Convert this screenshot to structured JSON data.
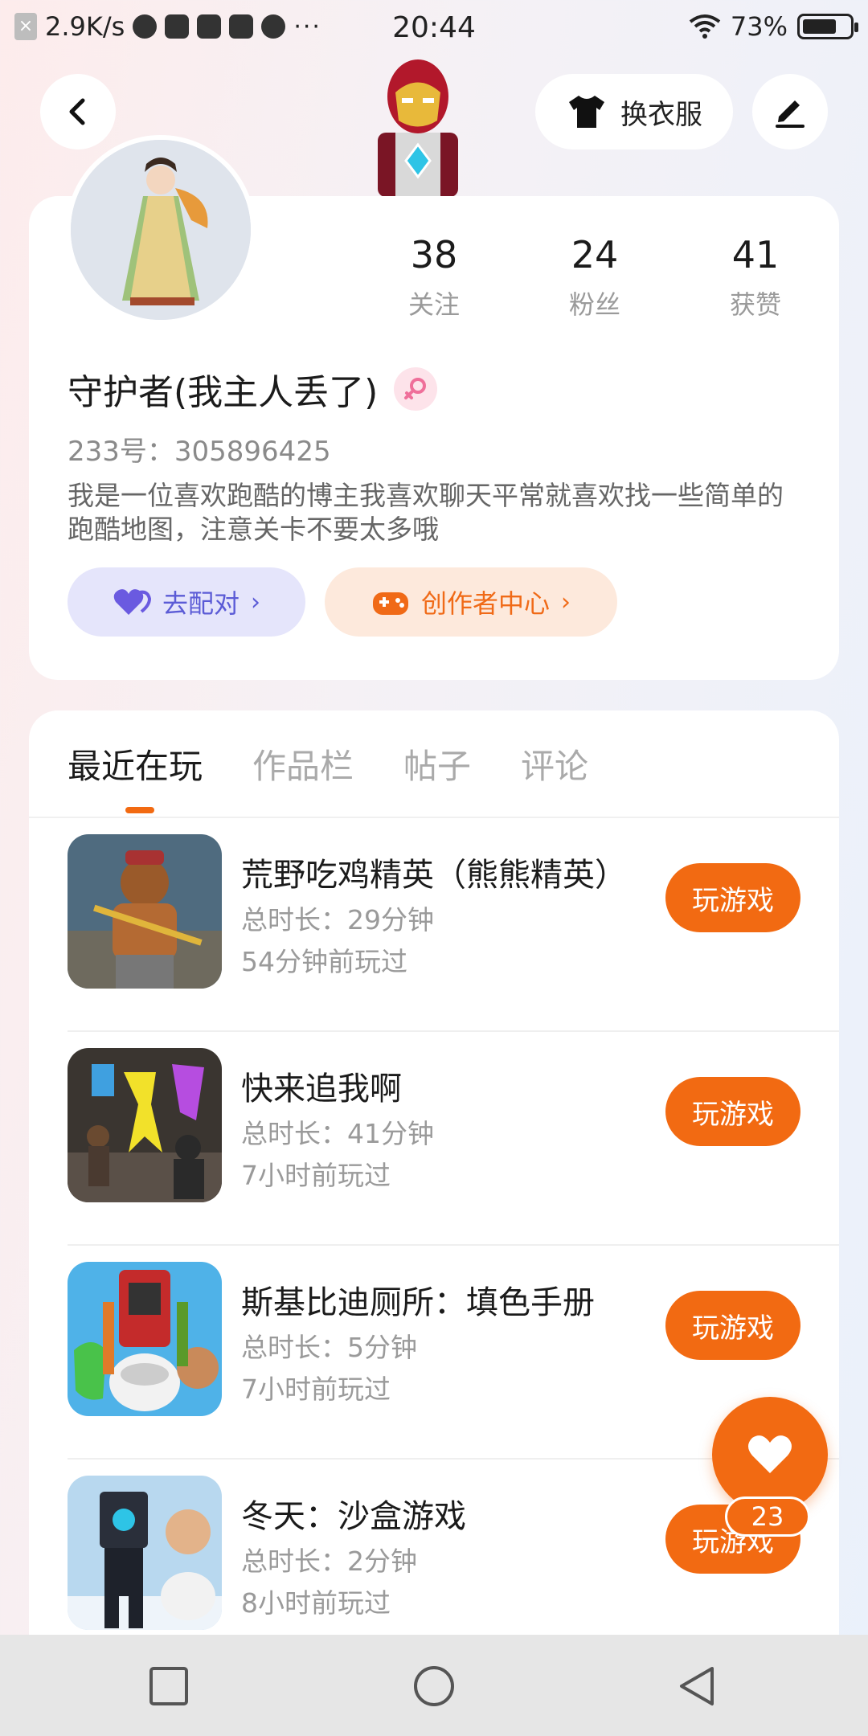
{
  "status_bar": {
    "net_speed": "2.9K/s",
    "time": "20:44",
    "battery": "73%",
    "battery_level": 0.73,
    "overflow": "···"
  },
  "top_bar": {
    "back_icon": "back-arrow-icon",
    "outfit_label": "换衣服",
    "outfit_icon": "shirt-icon",
    "edit_icon": "pen-icon"
  },
  "profile": {
    "stats": [
      {
        "value": "38",
        "label": "关注"
      },
      {
        "value": "24",
        "label": "粉丝"
      },
      {
        "value": "41",
        "label": "获赞"
      }
    ],
    "username": "守护者(我主人丢了)",
    "gender_icon": "female-icon",
    "user_id": "233号：305896425",
    "bio": "我是一位喜欢跑酷的博主我喜欢聊天平常就喜欢找一些简单的跑酷地图，注意关卡不要太多哦",
    "match_label": "去配对",
    "creator_label": "创作者中心"
  },
  "tabs": [
    {
      "label": "最近在玩",
      "active": true
    },
    {
      "label": "作品栏",
      "active": false
    },
    {
      "label": "帖子",
      "active": false
    },
    {
      "label": "评论",
      "active": false
    }
  ],
  "games": [
    {
      "title": "荒野吃鸡精英（熊熊精英）",
      "duration": "总时长：29分钟",
      "last_played": "54分钟前玩过",
      "play_label": "玩游戏"
    },
    {
      "title": "快来追我啊",
      "duration": "总时长：41分钟",
      "last_played": "7小时前玩过",
      "play_label": "玩游戏"
    },
    {
      "title": "斯基比迪厕所：填色手册",
      "duration": "总时长：5分钟",
      "last_played": "7小时前玩过",
      "play_label": "玩游戏"
    },
    {
      "title": "冬天：沙盒游戏",
      "duration": "总时长：2分钟",
      "last_played": "8小时前玩过",
      "play_label": "玩游戏"
    }
  ],
  "like_fab": {
    "count": "23",
    "icon": "heart-icon"
  },
  "colors": {
    "accent": "#f26a12",
    "match": "#5b5bd6",
    "match_bg": "#e5e5fb",
    "creator_bg": "#fde9dc"
  }
}
